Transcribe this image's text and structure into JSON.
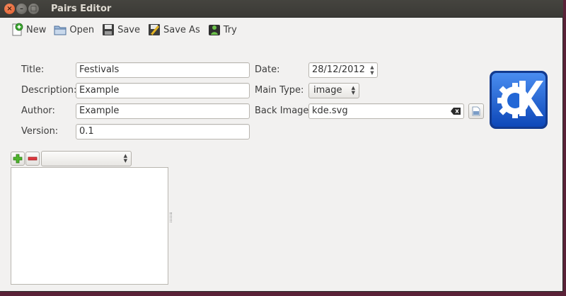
{
  "window": {
    "title": "Pairs Editor"
  },
  "toolbar": {
    "new_label": "New",
    "open_label": "Open",
    "save_label": "Save",
    "save_as_label": "Save As",
    "try_label": "Try"
  },
  "form": {
    "title_label": "Title:",
    "title_value": "Festivals",
    "description_label": "Description:",
    "description_value": "Example",
    "author_label": "Author:",
    "author_value": "Example",
    "version_label": "Version:",
    "version_value": "0.1",
    "date_label": "Date:",
    "date_value": "28/12/2012",
    "main_type_label": "Main Type:",
    "main_type_value": "image",
    "back_image_label": "Back Image:",
    "back_image_value": "kde.svg"
  },
  "list": {
    "selector_value": ""
  },
  "colors": {
    "window_bg": "#f2f1f0",
    "titlebar_bg": "#3c3b37",
    "close_button": "#e95420",
    "kde_blue": "#1d64d6"
  },
  "icons": [
    "new-icon",
    "open-icon",
    "save-icon",
    "save-as-icon",
    "try-icon",
    "clear-icon",
    "file-browse-icon",
    "add-icon",
    "remove-icon",
    "kde-logo"
  ]
}
